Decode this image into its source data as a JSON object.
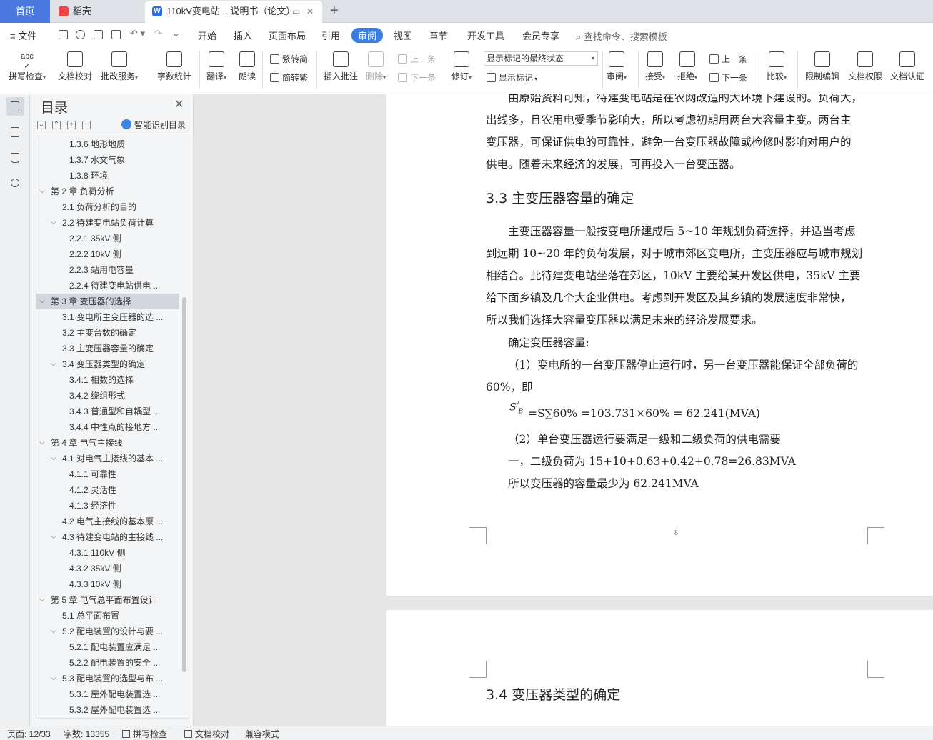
{
  "tabs": {
    "home": "首页",
    "t1": "稻壳",
    "t2": "110kV变电站... 说明书（论文）"
  },
  "menu": {
    "file": "文件",
    "items": [
      "开始",
      "插入",
      "页面布局",
      "引用",
      "审阅",
      "视图",
      "章节",
      "开发工具",
      "会员专享"
    ],
    "active": "审阅",
    "search": "查找命令、搜索模板"
  },
  "ribbon": {
    "spell": "拼写检查",
    "proof": "文档校对",
    "batch": "批改服务",
    "wordcount": "字数统计",
    "translate": "翻译",
    "read": "朗读",
    "trad2simp": "繁转简",
    "simp2trad": "简转繁",
    "insert_comment": "插入批注",
    "delete": "删除",
    "prev_comment": "上一条",
    "next_comment": "下一条",
    "revise": "修订",
    "markup_state": "显示标记的最终状态",
    "show_markup": "显示标记",
    "review": "审阅",
    "accept": "接受",
    "reject": "拒绝",
    "prev_change": "上一条",
    "next_change": "下一条",
    "compare": "比较",
    "restrict": "限制编辑",
    "permission": "文档权限",
    "certify": "文档认证"
  },
  "toc": {
    "title": "目录",
    "smart": "智能识别目录",
    "items": [
      {
        "text": "1.3.6 地形地质",
        "level": 3
      },
      {
        "text": "1.3.7 水文气象",
        "level": 3
      },
      {
        "text": "1.3.8 环境",
        "level": 3
      },
      {
        "text": "第 2 章  负荷分析",
        "level": 1,
        "expand": true
      },
      {
        "text": "2.1 负荷分析的目的",
        "level": 2
      },
      {
        "text": "2.2 待建变电站负荷计算",
        "level": 2,
        "expand": true
      },
      {
        "text": "2.2.1  35kV 侧",
        "level": 3
      },
      {
        "text": "2.2.2  10kV 侧",
        "level": 3
      },
      {
        "text": "2.2.3   站用电容量",
        "level": 3
      },
      {
        "text": "2.2.4   待建变电站供电 ...",
        "level": 3
      },
      {
        "text": "第 3 章  变压器的选择",
        "level": 1,
        "expand": true,
        "selected": true
      },
      {
        "text": "3.1 变电所主变压器的选 ...",
        "level": 2
      },
      {
        "text": "3.2 主变台数的确定",
        "level": 2
      },
      {
        "text": "3.3 主变压器容量的确定",
        "level": 2
      },
      {
        "text": "3.4   变压器类型的确定",
        "level": 2,
        "expand": true
      },
      {
        "text": "3.4.1 相数的选择",
        "level": 3
      },
      {
        "text": "3.4.2   绕组形式",
        "level": 3
      },
      {
        "text": "3.4.3   普通型和自耦型 ...",
        "level": 3
      },
      {
        "text": "3.4.4   中性点的接地方 ...",
        "level": 3
      },
      {
        "text": "第 4 章  电气主接线",
        "level": 1,
        "expand": true
      },
      {
        "text": "4.1 对电气主接线的基本 ...",
        "level": 2,
        "expand": true
      },
      {
        "text": "4.1.1 可靠性",
        "level": 3
      },
      {
        "text": "4.1.2 灵活性",
        "level": 3
      },
      {
        "text": "4.1.3 经济性",
        "level": 3
      },
      {
        "text": "4.2 电气主接线的基本原 ...",
        "level": 2
      },
      {
        "text": "4.3 待建变电站的主接线 ...",
        "level": 2,
        "expand": true
      },
      {
        "text": "4.3.1 110kV 侧",
        "level": 3
      },
      {
        "text": "4.3.2 35kV 侧",
        "level": 3
      },
      {
        "text": "4.3.3 10kV 侧",
        "level": 3
      },
      {
        "text": "第 5 章  电气总平面布置设计",
        "level": 1,
        "expand": true
      },
      {
        "text": "5.1 总平面布置",
        "level": 2
      },
      {
        "text": "5.2 配电装置的设计与要 ...",
        "level": 2,
        "expand": true
      },
      {
        "text": "5.2.1   配电装置应满足 ...",
        "level": 3
      },
      {
        "text": "5.2.2   配电装置的安全 ...",
        "level": 3
      },
      {
        "text": "5.3   配电装置的选型与布 ...",
        "level": 2,
        "expand": true
      },
      {
        "text": "5.3.1   屋外配电装置选 ...",
        "level": 3
      },
      {
        "text": "5.3.2   屋外配电装置选 ...",
        "level": 3
      }
    ]
  },
  "doc": {
    "line0": "由原始资料可知，待建变电站是在农网改造的大环境下建设的。负荷大，",
    "line1": "出线多，且农用电受季节影响大，所以考虑初期用两台大容量主变。两台主",
    "line2": "变压器，可保证供电的可靠性，避免一台变压器故障或检修时影响对用户的",
    "line3": "供电。随着未来经济的发展，可再投入一台变压器。",
    "heading33": "3.3 主变压器容量的确定",
    "p1": "主变压器容量一般按变电所建成后  5~10  年规划负荷选择，并适当考虑",
    "p2": "到远期  10~20  年的负荷发展，对于城市郊区变电所，主变压器应与城市规划",
    "p3": "相结合。此待建变电站坐落在郊区，10kV 主要给某开发区供电，35kV 主要",
    "p4": "给下面乡镇及几个大企业供电。考虑到开发区及其乡镇的发展速度非常快，",
    "p5": "所以我们选择大容量变压器以满足未来的经济发展要求。",
    "p6": "确定变压器容量:",
    "p7": "（1）变电所的一台变压器停止运行时，另一台变压器能保证全部负荷的",
    "p8": "60%，即",
    "formula_sym": "S",
    "formula_sup": "/",
    "formula_sub": "B",
    "formula": "=S∑60%  =103.731×60% = 62.241(MVA)",
    "p9": "（2）单台变压器运行要满足一级和二级负荷的供电需要",
    "p10": "一，二级负荷为     15+10+0.63+0.42+0.78=26.83MVA",
    "p11": "所以变压器的容量最少为 62.241MVA",
    "page_no": "8",
    "heading34": "3.4  变压器类型的确定"
  },
  "status": {
    "page": "页面: 12/33",
    "words": "字数: 13355",
    "spell": "拼写检查",
    "proof": "文档校对",
    "mode": "兼容模式"
  },
  "colors": {
    "accent": "#3b7de0",
    "home_tab": "#4a7ae0"
  }
}
